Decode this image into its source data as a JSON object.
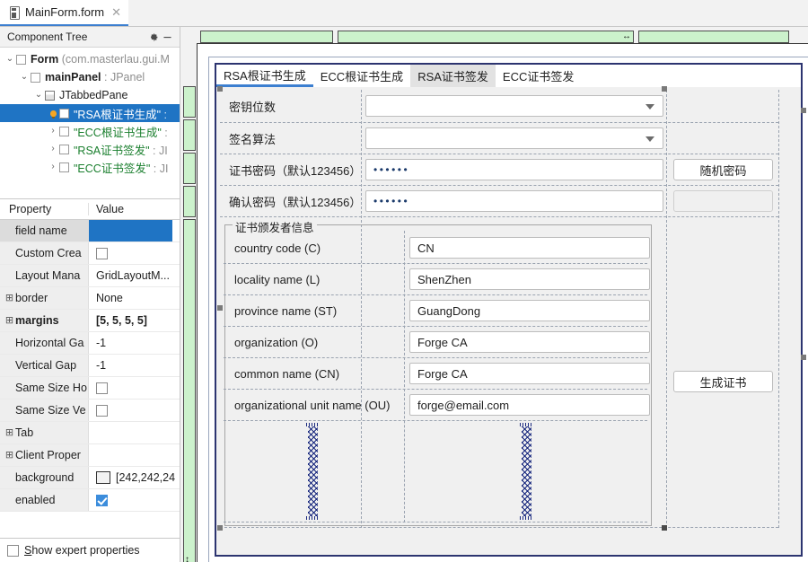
{
  "editor": {
    "tab_label": "MainForm.form",
    "tab_close": "✕",
    "icon_name": "form-file-icon"
  },
  "component_tree": {
    "header": "Component Tree",
    "settings_icon": "gear-icon",
    "minimize_icon": "minimize-icon",
    "nodes": [
      {
        "indent": 0,
        "twisty": "⌄",
        "bulb": false,
        "name": "Form ",
        "cls": "(com.masterlau.gui.M",
        "selected": false
      },
      {
        "indent": 1,
        "twisty": "⌄",
        "bulb": false,
        "name": "mainPanel",
        "cls": " : JPanel",
        "bold": true,
        "selected": false
      },
      {
        "indent": 2,
        "twisty": "⌄",
        "bulb": false,
        "name": "JTabbedPane",
        "cls": "",
        "selected": false
      },
      {
        "indent": 3,
        "twisty": "",
        "bulb": true,
        "name": "\"RSA根证书生成\"",
        "cls": " : ",
        "selected": true
      },
      {
        "indent": 3,
        "twisty": "›",
        "bulb": false,
        "name": "\"ECC根证书生成\"",
        "cls": " : ",
        "selected": false
      },
      {
        "indent": 3,
        "twisty": "›",
        "bulb": false,
        "name": "\"RSA证书签发\"",
        "cls": " : JI",
        "selected": false
      },
      {
        "indent": 3,
        "twisty": "›",
        "bulb": false,
        "name": "\"ECC证书签发\"",
        "cls": " : JI",
        "selected": false
      }
    ]
  },
  "properties": {
    "col_property": "Property",
    "col_value": "Value",
    "rows": [
      {
        "expander": "",
        "name": "field name",
        "indent": true,
        "bold": false,
        "value": "",
        "kind": "selected-empty"
      },
      {
        "expander": "",
        "name": "Custom Crea",
        "indent": true,
        "bold": false,
        "value": "",
        "kind": "checkbox-off"
      },
      {
        "expander": "",
        "name": "Layout Mana",
        "indent": true,
        "bold": false,
        "value": "GridLayoutM...",
        "kind": "text"
      },
      {
        "expander": "⊞",
        "name": "border",
        "indent": false,
        "bold": false,
        "value": "None",
        "kind": "text"
      },
      {
        "expander": "⊞",
        "name": "margins",
        "indent": false,
        "bold": true,
        "value": "[5, 5, 5, 5]",
        "kind": "text"
      },
      {
        "expander": "",
        "name": "Horizontal Ga",
        "indent": true,
        "bold": false,
        "value": "-1",
        "kind": "text"
      },
      {
        "expander": "",
        "name": "Vertical Gap",
        "indent": true,
        "bold": false,
        "value": "-1",
        "kind": "text"
      },
      {
        "expander": "",
        "name": "Same Size Ho",
        "indent": true,
        "bold": false,
        "value": "",
        "kind": "checkbox-off"
      },
      {
        "expander": "",
        "name": "Same Size Ve",
        "indent": true,
        "bold": false,
        "value": "",
        "kind": "checkbox-off"
      },
      {
        "expander": "⊞",
        "name": "Tab",
        "indent": false,
        "bold": false,
        "value": "",
        "kind": "text"
      },
      {
        "expander": "⊞",
        "name": "Client Proper",
        "indent": false,
        "bold": false,
        "value": "",
        "kind": "text"
      },
      {
        "expander": "",
        "name": "background",
        "indent": true,
        "bold": false,
        "value": "[242,242,24",
        "kind": "color"
      },
      {
        "expander": "",
        "name": "enabled",
        "indent": true,
        "bold": false,
        "value": "",
        "kind": "checkbox-on"
      }
    ],
    "expert_checkbox_label_prefix": "S",
    "expert_checkbox_label_rest": "how expert properties"
  },
  "colors": {
    "selection_blue": "#1f74c4",
    "ruler_green": "#ccf2cc",
    "tab_underline": "#3c7fd0",
    "panel_border_navy": "#2c3470",
    "grid_dash": "#9aa3b0"
  },
  "designer": {
    "form_tabs": [
      {
        "label": "RSA根证书生成",
        "state": "active"
      },
      {
        "label": "ECC根证书生成",
        "state": "normal"
      },
      {
        "label": "RSA证书签发",
        "state": "hover"
      },
      {
        "label": "ECC证书签发",
        "state": "normal"
      }
    ],
    "top_fields": [
      {
        "label": "密钥位数",
        "control": "combo",
        "value": ""
      },
      {
        "label": "签名算法",
        "control": "combo",
        "value": ""
      },
      {
        "label": "证书密码（默认123456）",
        "control": "password",
        "value": "••••••"
      },
      {
        "label": "确认密码（默认123456）",
        "control": "password",
        "value": "••••••"
      }
    ],
    "buttons": {
      "random_password": "随机密码",
      "generate_certificate": "生成证书"
    },
    "issuer_group": {
      "title": "证书颁发者信息",
      "fields": [
        {
          "label": "country code (C)",
          "value": "CN"
        },
        {
          "label": "locality name (L)",
          "value": "ShenZhen"
        },
        {
          "label": "province name (ST)",
          "value": "GuangDong"
        },
        {
          "label": "organization (O)",
          "value": "Forge CA"
        },
        {
          "label": "common name (CN)",
          "value": "Forge CA"
        },
        {
          "label": "organizational unit name (OU)",
          "value": "forge@email.com"
        }
      ]
    },
    "ruler_h_segments": [
      {
        "handle": ""
      },
      {
        "handle": "↔"
      },
      {
        "handle": ""
      }
    ],
    "ruler_v_segments": [
      {
        "handle": ""
      },
      {
        "handle": ""
      },
      {
        "handle": ""
      },
      {
        "handle": ""
      },
      {
        "handle": "↕"
      }
    ]
  }
}
